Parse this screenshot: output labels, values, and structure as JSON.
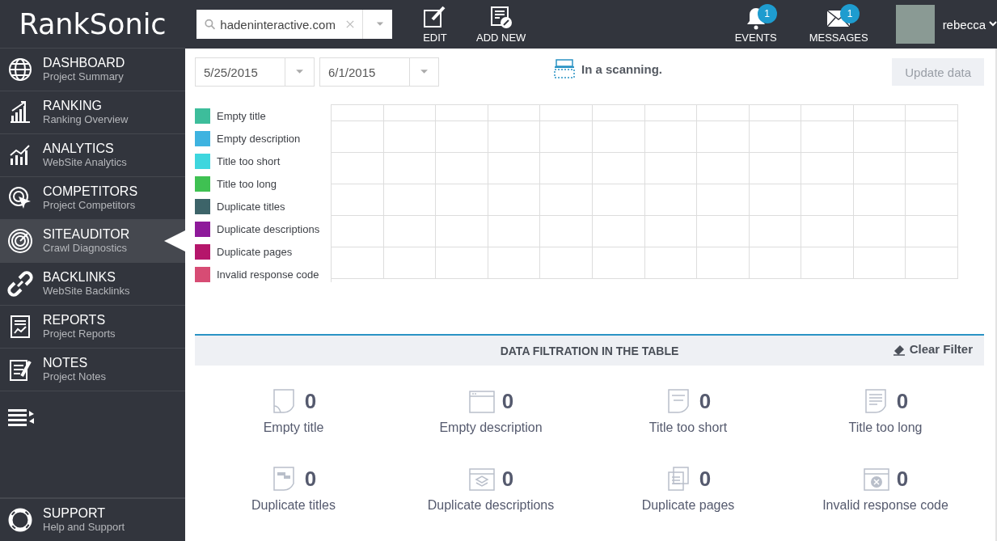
{
  "logo": "RankSonic",
  "search": {
    "value": "hadeninteractive.com"
  },
  "toolbar": [
    {
      "label": "EDIT"
    },
    {
      "label": "ADD NEW"
    }
  ],
  "notifications": [
    {
      "label": "EVENTS",
      "badge": "1"
    },
    {
      "label": "MESSAGES",
      "badge": "1"
    }
  ],
  "user": {
    "name": "rebecca"
  },
  "sidebar": {
    "items": [
      {
        "title": "DASHBOARD",
        "subtitle": "Project Summary",
        "selected": false
      },
      {
        "title": "RANKING",
        "subtitle": "Ranking Overview",
        "selected": false
      },
      {
        "title": "ANALYTICS",
        "subtitle": "WebSite Analytics",
        "selected": false
      },
      {
        "title": "COMPETITORS",
        "subtitle": "Project Competitors",
        "selected": false
      },
      {
        "title": "SITEAUDITOR",
        "subtitle": "Crawl Diagnostics",
        "selected": true
      },
      {
        "title": "BACKLINKS",
        "subtitle": "WebSite Backlinks",
        "selected": false
      },
      {
        "title": "REPORTS",
        "subtitle": "Project Reports",
        "selected": false
      },
      {
        "title": "NOTES",
        "subtitle": "Project Notes",
        "selected": false
      }
    ],
    "support": {
      "title": "SUPPORT",
      "subtitle": "Help and Support"
    }
  },
  "dates": [
    {
      "value": "5/25/2015"
    },
    {
      "value": "6/1/2015"
    }
  ],
  "status": "In a scanning.",
  "update_button": "Update data",
  "legend": [
    {
      "label": "Empty title",
      "color": "#3dbd9b"
    },
    {
      "label": "Empty description",
      "color": "#3eb3e0"
    },
    {
      "label": "Title too short",
      "color": "#3ed6de"
    },
    {
      "label": "Title too long",
      "color": "#3fc152"
    },
    {
      "label": "Duplicate titles",
      "color": "#3d6469"
    },
    {
      "label": "Duplicate descriptions",
      "color": "#8e1a9a"
    },
    {
      "label": "Duplicate pages",
      "color": "#b5166b"
    },
    {
      "label": "Invalid response code",
      "color": "#d74c74"
    }
  ],
  "filter": {
    "title": "DATA FILTRATION IN THE TABLE",
    "clear": "Clear Filter"
  },
  "stats": [
    {
      "label": "Empty title",
      "count": "0"
    },
    {
      "label": "Empty description",
      "count": "0"
    },
    {
      "label": "Title too short",
      "count": "0"
    },
    {
      "label": "Title too long",
      "count": "0"
    },
    {
      "label": "Duplicate titles",
      "count": "0"
    },
    {
      "label": "Duplicate descriptions",
      "count": "0"
    },
    {
      "label": "Duplicate pages",
      "count": "0"
    },
    {
      "label": "Invalid response code",
      "count": "0"
    }
  ]
}
